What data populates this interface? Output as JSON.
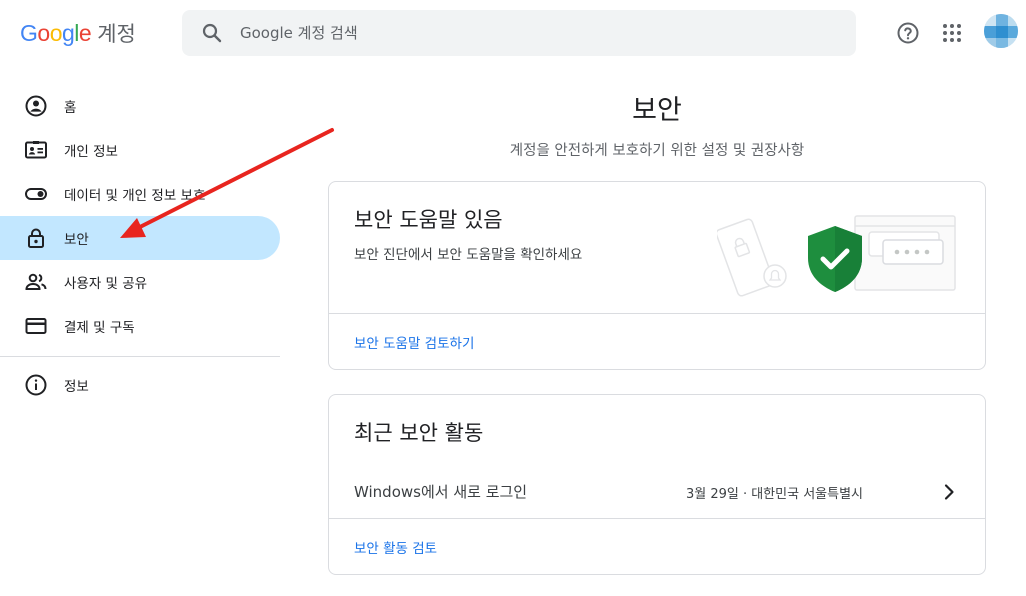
{
  "header": {
    "logo": {
      "google": [
        "G",
        "o",
        "o",
        "g",
        "l",
        "e"
      ],
      "product": "계정"
    },
    "search": {
      "placeholder": "Google 계정 검색"
    },
    "icons": {
      "search": "search-icon",
      "help": "help-icon",
      "apps": "apps-grid-icon",
      "avatar": "avatar"
    }
  },
  "sidebar": {
    "items": [
      {
        "label": "홈",
        "icon": "home-account-icon"
      },
      {
        "label": "개인 정보",
        "icon": "id-card-icon"
      },
      {
        "label": "데이터 및 개인 정보 보호",
        "icon": "toggle-icon"
      },
      {
        "label": "보안",
        "icon": "lock-icon",
        "active": true
      },
      {
        "label": "사용자 및 공유",
        "icon": "people-icon"
      },
      {
        "label": "결제 및 구독",
        "icon": "credit-card-icon"
      }
    ],
    "footer_items": [
      {
        "label": "정보",
        "icon": "info-icon"
      }
    ]
  },
  "main": {
    "title": "보안",
    "subtitle": "계정을 안전하게 보호하기 위한 설정 및 권장사항",
    "security_tips_card": {
      "title": "보안 도움말 있음",
      "description": "보안 진단에서 보안 도움말을 확인하세요",
      "link": "보안 도움말 검토하기"
    },
    "recent_activity_card": {
      "title": "최근 보안 활동",
      "activity": {
        "label": "Windows에서 새로 로그인",
        "meta": "3월 29일 · 대한민국 서울특별시"
      },
      "link": "보안 활동 검토"
    }
  },
  "colors": {
    "active_nav_bg": "#c2e7ff",
    "link": "#1a73e8",
    "shield": "#1e8e3e",
    "annotation_arrow": "#e8251f"
  }
}
